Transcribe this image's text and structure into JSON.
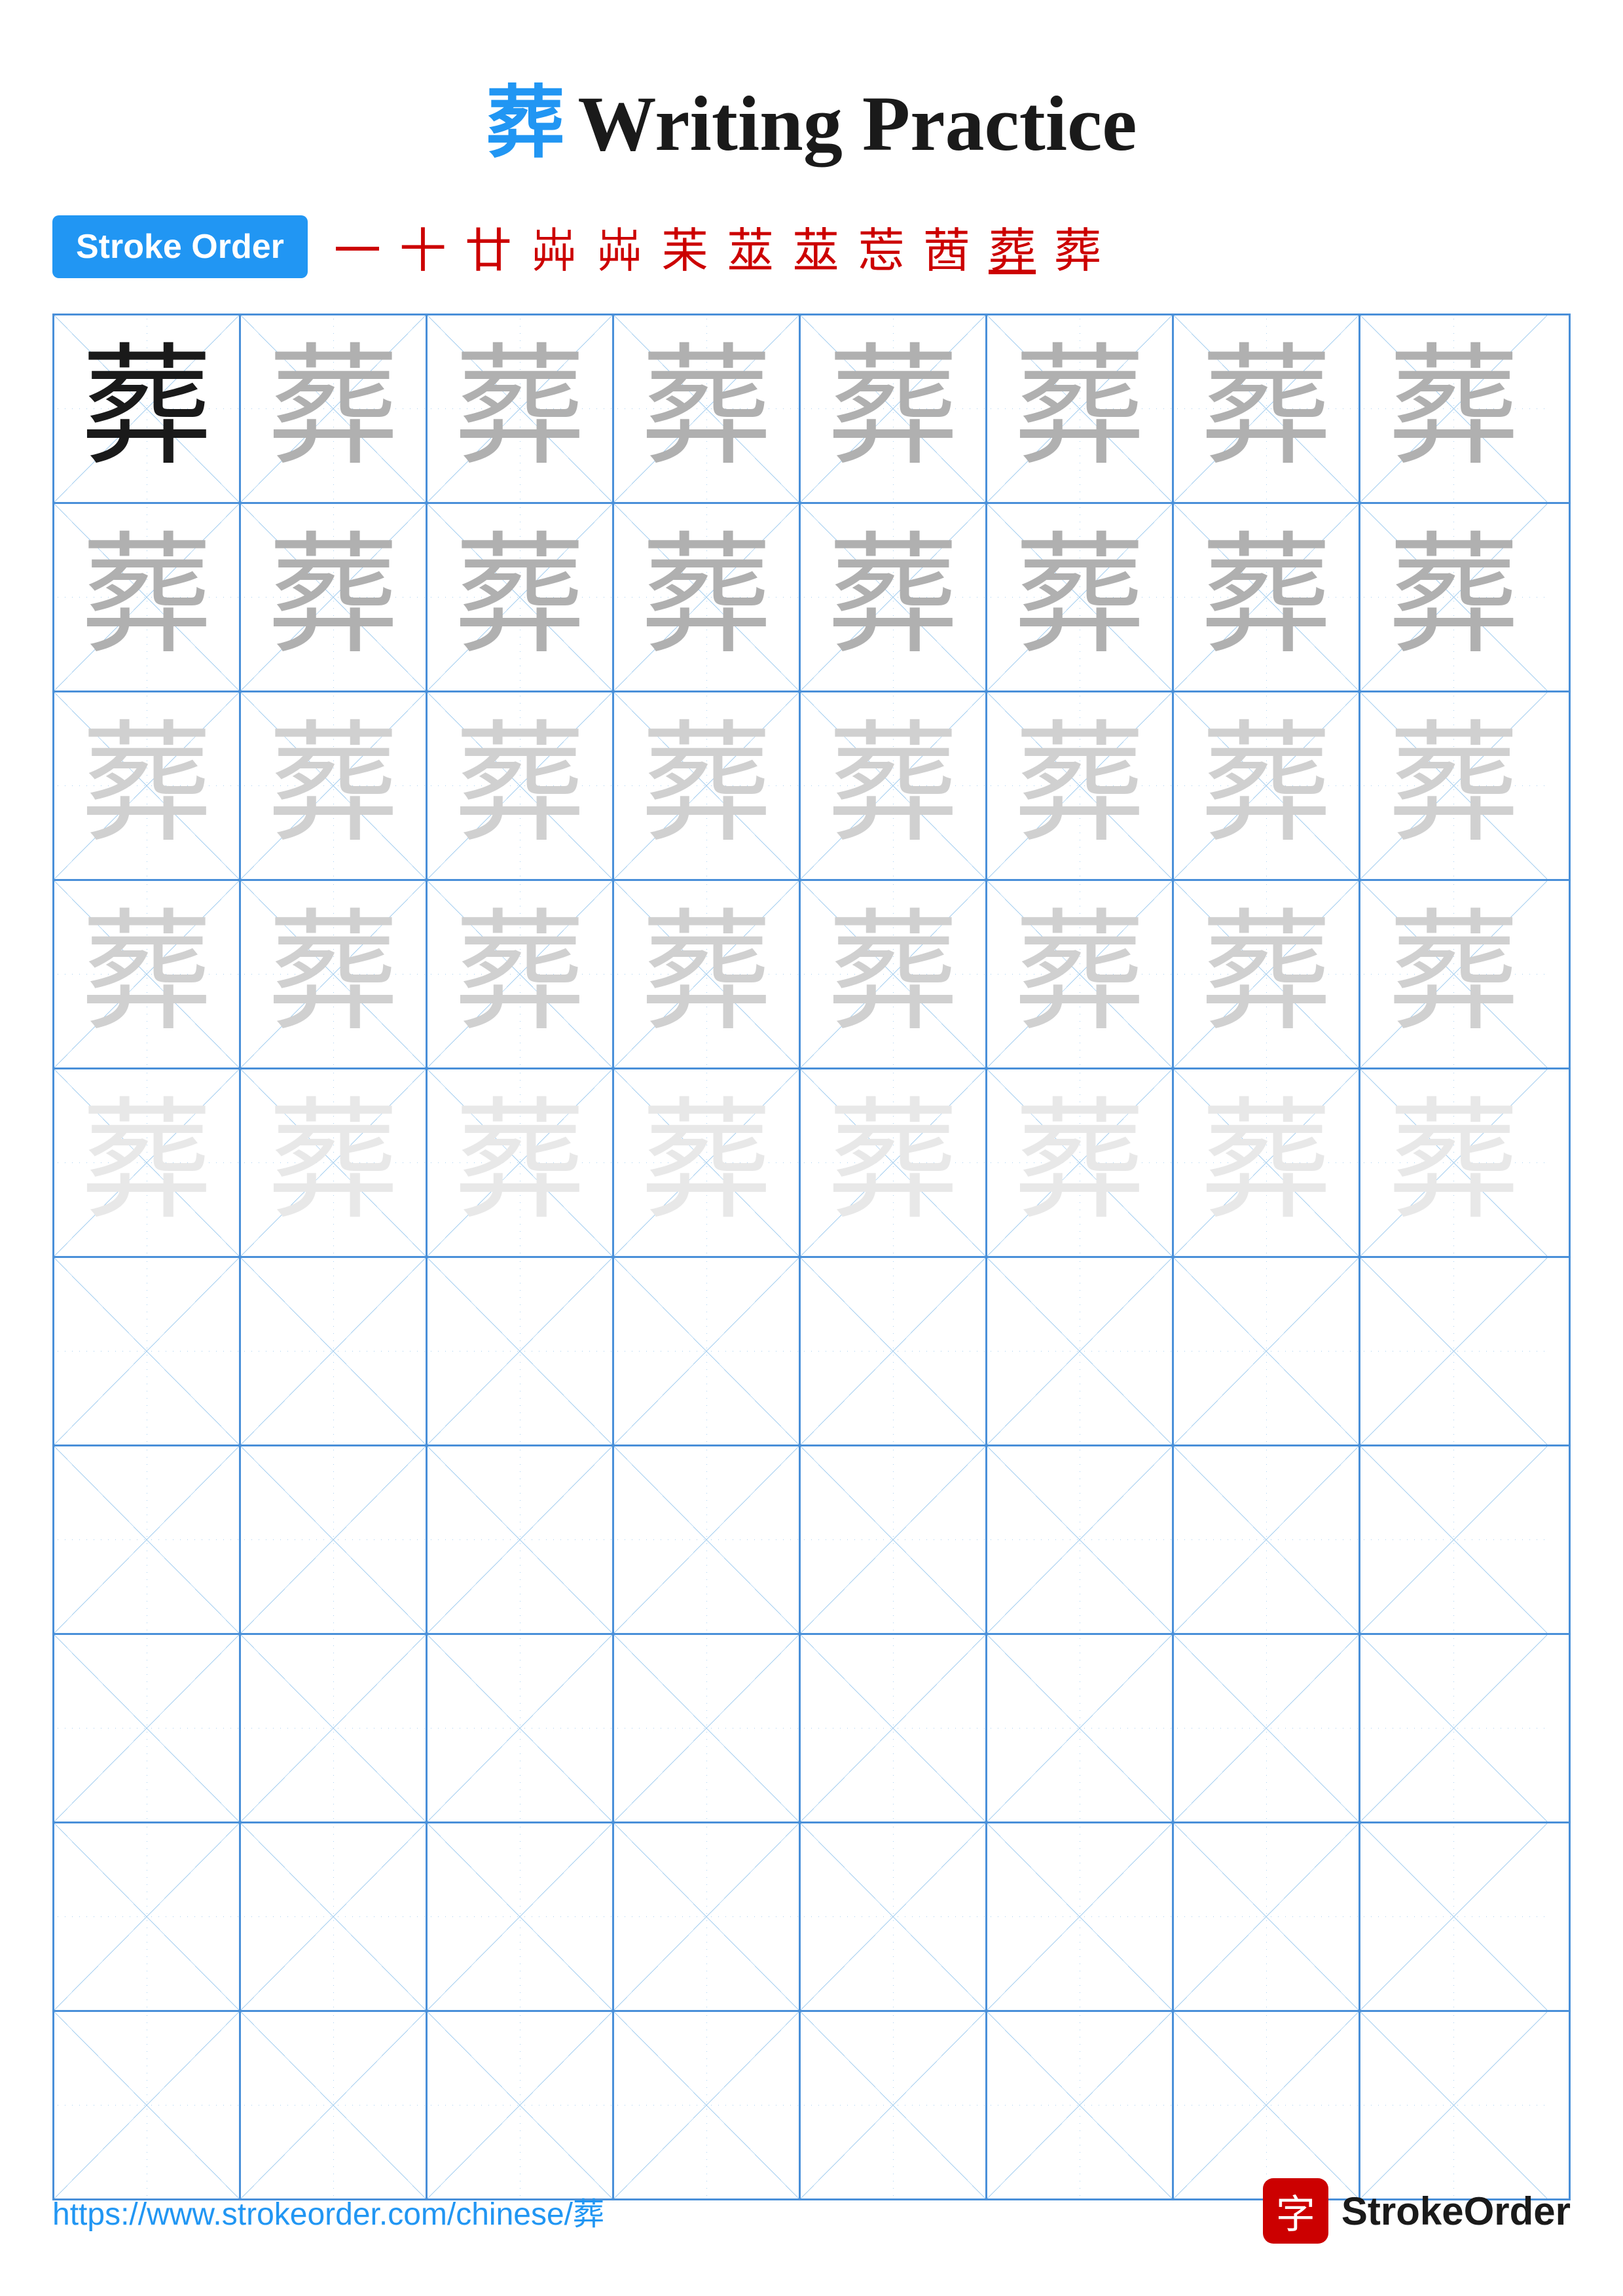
{
  "page": {
    "title": "Writing Practice",
    "char": "葬",
    "char_color": "#2196F3"
  },
  "stroke_order": {
    "badge_label": "Stroke Order",
    "strokes": [
      "一",
      "十",
      "廿",
      "芔",
      "芔",
      "苿",
      "莁",
      "莁",
      "莣",
      "莤",
      "葬",
      "葬"
    ]
  },
  "grid": {
    "rows": 10,
    "cols": 8,
    "practice_char": "葬"
  },
  "footer": {
    "url": "https://www.strokeorder.com/chinese/葬",
    "logo_char": "字",
    "logo_text": "StrokeOrder"
  }
}
